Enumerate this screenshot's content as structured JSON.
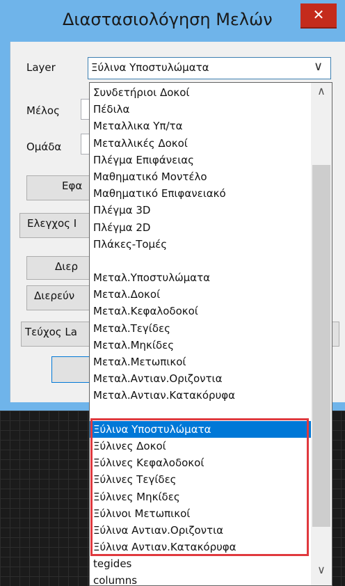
{
  "window": {
    "title": "Διαστασιολόγηση Μελών",
    "close_glyph": "✕"
  },
  "form": {
    "layer_label": "Layer",
    "member_label": "Μέλος",
    "group_label": "Ομάδα",
    "layer_selected": "Ξύλινα Υποστυλώματα",
    "chevron": "∨"
  },
  "buttons": {
    "apply_partial": "Εφα",
    "check_partial": "Ελεγχος Ι",
    "investigate1_partial": "Διερ",
    "investigate2_partial": "Διερεύν",
    "booklet_partial": "Τεύχος La"
  },
  "dropdown": {
    "items": [
      "Συνδετήριοι Δοκοί",
      "Πέδιλα",
      "Μεταλλικα Υπ/τα",
      "Μεταλλικές Δοκοί",
      "Πλέγμα Επιφάνειας",
      "Μαθηματικό Μοντέλο",
      "Μαθηματικό Επιφανειακό",
      "Πλέγμα 3D",
      "Πλέγμα 2D",
      "Πλάκες-Τομές",
      "",
      "Μεταλ.Υποστυλώματα",
      "Μεταλ.Δοκοί",
      "Μεταλ.Κεφαλοδοκοί",
      "Μεταλ.Τεγίδες",
      "Μεταλ.Μηκίδες",
      "Μεταλ.Μετωπικοί",
      "Μεταλ.Αντιαν.Οριζοντια",
      "Μεταλ.Αντιαν.Κατακόρυφα",
      "",
      "Ξύλινα Υποστυλώματα",
      "Ξύλινες Δοκοί",
      "Ξύλινες Κεφαλοδοκοί",
      "Ξύλινες Τεγίδες",
      "Ξύλινες Μηκίδες",
      "Ξύλινοι Μετωπικοί",
      "Ξύλινα Αντιαν.Οριζοντια",
      "Ξύλινα Αντιαν.Κατακόρυφα",
      "tegides",
      "columns"
    ],
    "selected_index": 20,
    "scroll_up": "∧",
    "scroll_down": "∨"
  },
  "colors": {
    "title_bar": "#6fb4ea",
    "close_button": "#c42b1c",
    "selection": "#0078d7",
    "highlight_box": "#e0393e"
  }
}
